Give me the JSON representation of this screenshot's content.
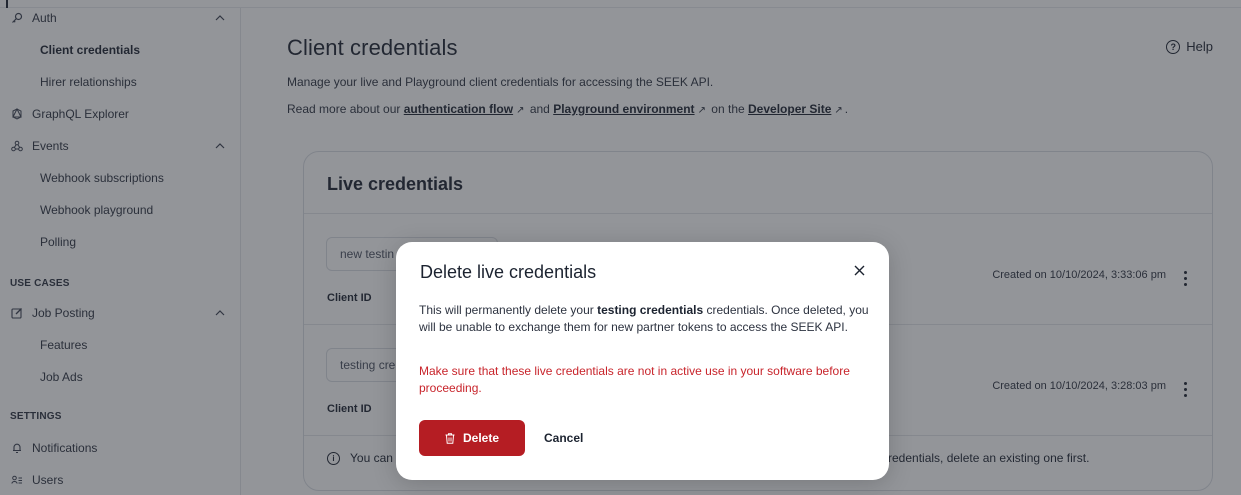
{
  "sidebar": {
    "auth": {
      "label": "Auth",
      "icon": "key-icon"
    },
    "auth_items": [
      "Client credentials",
      "Hirer relationships"
    ],
    "graphql": {
      "label": "GraphQL Explorer",
      "icon": "graphql-icon"
    },
    "events": {
      "label": "Events",
      "icon": "webhook-icon"
    },
    "events_items": [
      "Webhook subscriptions",
      "Webhook playground",
      "Polling"
    ],
    "use_cases_label": "USE CASES",
    "job_posting": {
      "label": "Job Posting",
      "icon": "edit-icon"
    },
    "job_posting_items": [
      "Features",
      "Job Ads"
    ],
    "settings_label": "SETTINGS",
    "notifications": {
      "label": "Notifications",
      "icon": "bell-icon"
    },
    "users": {
      "label": "Users",
      "icon": "users-icon"
    },
    "active_item": "Client credentials"
  },
  "header": {
    "title": "Client credentials",
    "help_label": "Help"
  },
  "intro": {
    "line1": "Manage your live and Playground client credentials for accessing the SEEK API.",
    "line2_prefix": "Read more about our",
    "link_auth": "authentication flow",
    "line2_and": "and",
    "link_playground": "Playground environment",
    "line2_on": "on the",
    "link_dev_site": "Developer Site",
    "line2_end": "."
  },
  "live_credentials": {
    "title": "Live credentials",
    "items": [
      {
        "name": "new testin",
        "client_id_label": "Client ID",
        "created": "Created on 10/10/2024, 3:33:06 pm"
      },
      {
        "name": "testing cre",
        "client_id_label": "Client ID",
        "created": "Created on 10/10/2024, 3:28:03 pm"
      }
    ],
    "info_prefix": "You can",
    "info_suffix": "credentials, delete an existing one first."
  },
  "modal": {
    "title": "Delete live credentials",
    "body_prefix": "This will permanently delete your",
    "body_bold": "testing credentials",
    "body_suffix": "credentials. Once deleted, you will be unable to exchange them for new partner tokens to access the SEEK API.",
    "warning": "Make sure that these live credentials are not in active use in your software before proceeding.",
    "delete_label": "Delete",
    "cancel_label": "Cancel"
  },
  "colors": {
    "danger": "#b51d23",
    "warning_text": "#c8242b",
    "overlay": "rgba(40,44,52,0.5)"
  }
}
